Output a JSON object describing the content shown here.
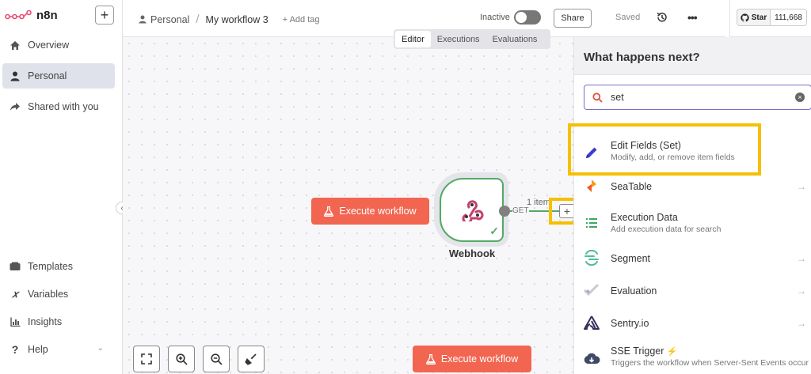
{
  "sidebar": {
    "logo_text": "n8n",
    "add_label": "+",
    "nav_top": [
      {
        "label": "Overview",
        "icon": "home-icon"
      },
      {
        "label": "Personal",
        "icon": "user-icon",
        "active": true
      },
      {
        "label": "Shared with you",
        "icon": "share-icon"
      }
    ],
    "nav_bottom": [
      {
        "label": "Templates",
        "icon": "templates-icon"
      },
      {
        "label": "Variables",
        "icon": "variables-icon"
      },
      {
        "label": "Insights",
        "icon": "insights-icon"
      },
      {
        "label": "Help",
        "icon": "help-icon"
      }
    ]
  },
  "header": {
    "breadcrumb_project": "Personal",
    "workflow_name": "My workflow 3",
    "add_tag": "+ Add tag",
    "status": "Inactive",
    "share_label": "Share",
    "saved_label": "Saved",
    "github": {
      "star_label": "Star",
      "count": "111,668"
    }
  },
  "tabs": [
    "Editor",
    "Executions",
    "Evaluations"
  ],
  "canvas": {
    "execute_label": "Execute workflow",
    "node_label": "Webhook",
    "connection_method": "GET",
    "connection_items": "1 item"
  },
  "panel": {
    "title": "What happens next?",
    "search_value": "set",
    "items": [
      {
        "title": "Edit Fields (Set)",
        "desc": "Modify, add, or remove item fields",
        "icon": "pencil-icon"
      },
      {
        "title": "SeaTable",
        "desc": "",
        "icon": "seatable-icon"
      },
      {
        "title": "Execution Data",
        "desc": "Add execution data for search",
        "icon": "list-icon"
      },
      {
        "title": "Segment",
        "desc": "",
        "icon": "segment-icon"
      },
      {
        "title": "Evaluation",
        "desc": "",
        "icon": "check-icon"
      },
      {
        "title": "Sentry.io",
        "desc": "",
        "icon": "sentry-icon"
      },
      {
        "title": "SSE Trigger",
        "desc": "Triggers the workflow when Server-Sent Events occur",
        "icon": "cloud-download-icon"
      }
    ]
  },
  "colors": {
    "accent": "#f26550",
    "node_success": "#53a964",
    "highlight": "#f5c000",
    "search_border": "#7a6fc7"
  }
}
